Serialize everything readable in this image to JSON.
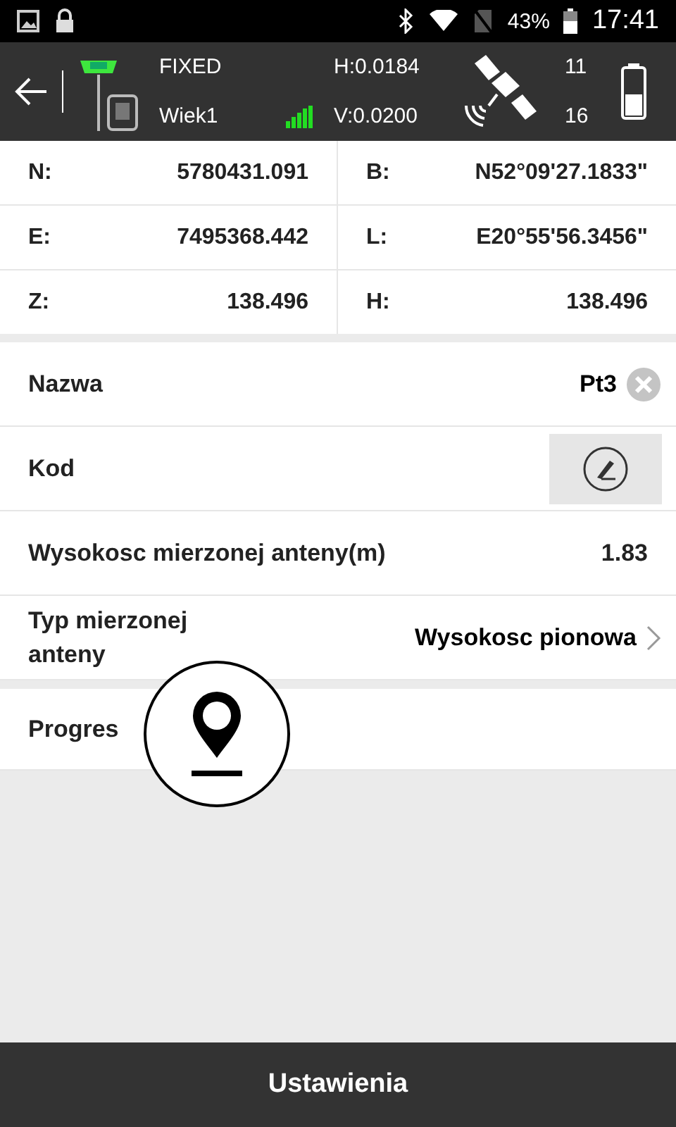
{
  "status_bar": {
    "battery": "43%",
    "time": "17:41"
  },
  "header": {
    "solution": "FIXED",
    "point": "Wiek1",
    "h_precision": "H:0.0184",
    "v_precision": "V:0.0200",
    "satellites_used": "11",
    "satellites_visible": "16"
  },
  "coordinates": [
    {
      "label": "N:",
      "value": "5780431.091"
    },
    {
      "label": "B:",
      "value": "N52°09'27.1833\""
    },
    {
      "label": "E:",
      "value": "7495368.442"
    },
    {
      "label": "L:",
      "value": "E20°55'56.3456\""
    },
    {
      "label": "Z:",
      "value": "138.496"
    },
    {
      "label": "H:",
      "value": "138.496"
    }
  ],
  "fields": [
    {
      "kind": "clearable",
      "label": "Nazwa",
      "value": "Pt3"
    },
    {
      "kind": "code",
      "label": "Kod"
    },
    {
      "kind": "value",
      "label": "Wysokosc mierzonej anteny(m)",
      "value": "1.83"
    },
    {
      "kind": "select",
      "label": "Typ mierzonej anteny",
      "value": "Wysokosc pionowa"
    }
  ],
  "progress": {
    "label": "Progres"
  },
  "bottom_button": "Ustawienia"
}
